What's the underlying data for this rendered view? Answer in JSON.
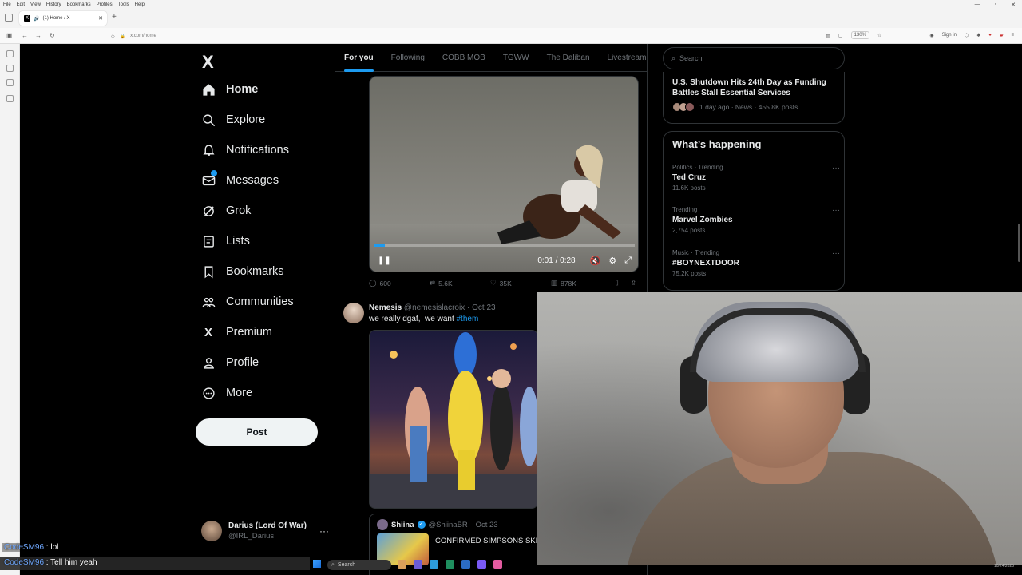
{
  "browser": {
    "menu": [
      "File",
      "Edit",
      "View",
      "History",
      "Bookmarks",
      "Profiles",
      "Tools",
      "Help"
    ],
    "tab_title": "(1) Home / X",
    "url": "x.com/home",
    "zoom": "130%",
    "sign_in": "Sign in"
  },
  "nav": {
    "logo": "X",
    "items": [
      {
        "label": "Home",
        "icon": "home-icon"
      },
      {
        "label": "Explore",
        "icon": "search-icon"
      },
      {
        "label": "Notifications",
        "icon": "bell-icon"
      },
      {
        "label": "Messages",
        "icon": "mail-icon"
      },
      {
        "label": "Grok",
        "icon": "grok-icon"
      },
      {
        "label": "Lists",
        "icon": "list-icon"
      },
      {
        "label": "Bookmarks",
        "icon": "bookmark-icon"
      },
      {
        "label": "Communities",
        "icon": "communities-icon"
      },
      {
        "label": "Premium",
        "icon": "x-icon"
      },
      {
        "label": "Profile",
        "icon": "person-icon"
      },
      {
        "label": "More",
        "icon": "more-icon"
      }
    ],
    "post_label": "Post",
    "account": {
      "name": "Darius (Lord Of War)",
      "handle": "@IRL_Darius"
    }
  },
  "timeline": {
    "tabs": [
      "For you",
      "Following",
      "COBB MOB",
      "TGWW",
      "The Daliban",
      "LivestreamFa"
    ],
    "video": {
      "time": "0:01 / 0:28",
      "progress": 0.04
    },
    "actions": {
      "replies": "600",
      "reposts": "5.6K",
      "likes": "35K",
      "views": "878K"
    },
    "tweet2": {
      "name": "Nemesis",
      "handle": "@nemesislacroix",
      "date": "· Oct 23",
      "text": "we really dgaf,  we want ",
      "hashtag": "#them"
    },
    "quote": {
      "name": "Shiina",
      "handle": "@ShiinaBR",
      "date": "· Oct 23",
      "text": "CONFIRMED SIMPSONS SKI"
    }
  },
  "right": {
    "search_placeholder": "Search",
    "news": {
      "title": "U.S. Shutdown Hits 24th Day as Funding Battles Stall Essential Services",
      "meta": "1 day ago · News · 455.8K posts"
    },
    "trending_header": "What’s happening",
    "trends": [
      {
        "context": "Politics · Trending",
        "name": "Ted Cruz",
        "count": "11.6K posts"
      },
      {
        "context": "Trending",
        "name": "Marvel Zombies",
        "count": "2,754 posts"
      },
      {
        "context": "Music · Trending",
        "name": "#BOYNEXTDOOR",
        "count": "75.2K posts"
      }
    ]
  },
  "chat": [
    {
      "user": "CodeSM96",
      "text": " : lol"
    },
    {
      "user": "CodeSM96",
      "text": " : Tell him yeah"
    }
  ],
  "taskbar": {
    "search": "Search",
    "date": "10/24/2025"
  }
}
